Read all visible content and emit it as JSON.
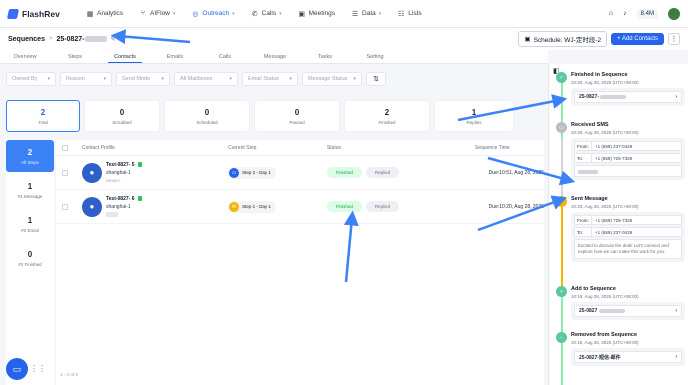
{
  "app": {
    "name": "FlashRev"
  },
  "nav": [
    {
      "label": "Analytics",
      "icon": "chart-icon",
      "caret": false
    },
    {
      "label": "AIFlow",
      "icon": "branch-icon",
      "caret": true
    },
    {
      "label": "Outreach",
      "icon": "send-icon",
      "caret": true
    },
    {
      "label": "Calls",
      "icon": "phone-icon",
      "caret": true
    },
    {
      "label": "Meetings",
      "icon": "calendar-icon",
      "caret": false
    },
    {
      "label": "Data",
      "icon": "database-icon",
      "caret": true
    },
    {
      "label": "Lists",
      "icon": "list-icon",
      "caret": false
    }
  ],
  "credits": "8.4M",
  "breadcrumb": {
    "root": "Sequences",
    "sep": ">",
    "current": "25-0827-"
  },
  "schedule": {
    "label": "Schedule: WJ-定时段-2"
  },
  "add_contacts": "Add Contacts",
  "tabs": [
    "Overview",
    "Steps",
    "Contacts",
    "Emails",
    "Calls",
    "Message",
    "Tasks",
    "Setting"
  ],
  "filters": [
    "Owned By",
    "Reason",
    "Send Mode",
    "All Mailboxes",
    "Email Status",
    "Message Status"
  ],
  "stats": [
    {
      "num": "2",
      "label": "Total"
    },
    {
      "num": "0",
      "label": "Scrubbed"
    },
    {
      "num": "0",
      "label": "Scheduled"
    },
    {
      "num": "0",
      "label": "Paused"
    },
    {
      "num": "2",
      "label": "Finished"
    },
    {
      "num": "1",
      "label": "Replies"
    }
  ],
  "steps": [
    {
      "num": "2",
      "label": "All Steps"
    },
    {
      "num": "1",
      "label": "#1 Message"
    },
    {
      "num": "1",
      "label": "#2 Email"
    },
    {
      "num": "0",
      "label": "#2 Finished"
    }
  ],
  "table": {
    "headers": [
      "Contact Profile",
      "Current Step",
      "Status",
      "Sequence Time"
    ],
    "rows": [
      {
        "name": "Test-0827- 5",
        "location": "shanghai-1",
        "extra": "RR0827",
        "step": "Step 2 - Day 1",
        "status": "Finished",
        "replied": "Replied",
        "time": "Due:10:51, Aug 28, 2025"
      },
      {
        "name": "Test-0827- 6",
        "location": "shanghai-1",
        "extra": "",
        "step": "Step 1 - Day 1",
        "status": "Finished",
        "replied": "Replied",
        "time": "Due:10:20, Aug 28, 2025"
      }
    ],
    "footer": "1 - 2 of 2"
  },
  "timeline": [
    {
      "title": "Finished in Sequence",
      "time": "10:20, Aug 28, 2025 (UTC+08:00)",
      "link": "25-0827-"
    },
    {
      "title": "Received SMS",
      "time": "10:20, Aug 28, 2025 (UTC+08:00)",
      "from": "+1 (659) 237-0429",
      "to": "+1 (659) 725-7329"
    },
    {
      "title": "Sent Message",
      "time": "10:20, Aug 28, 2025 (UTC+08:00)",
      "from": "+1 (659) 725-7329",
      "to": "+1 (659) 237-0429",
      "message": "Excited to discuss the deal! Let's connect and explore how we can make this work for you."
    },
    {
      "title": "Add to Sequence",
      "time": "10:19, Aug 28, 2025 (UTC+08:00)",
      "link": "25-0827"
    },
    {
      "title": "Removed from Sequence",
      "time": "10:19, Aug 28, 2025 (UTC+08:00)",
      "link": "25-0827-短信-邮件"
    }
  ],
  "labels": {
    "from": "From:",
    "to": "To:"
  }
}
